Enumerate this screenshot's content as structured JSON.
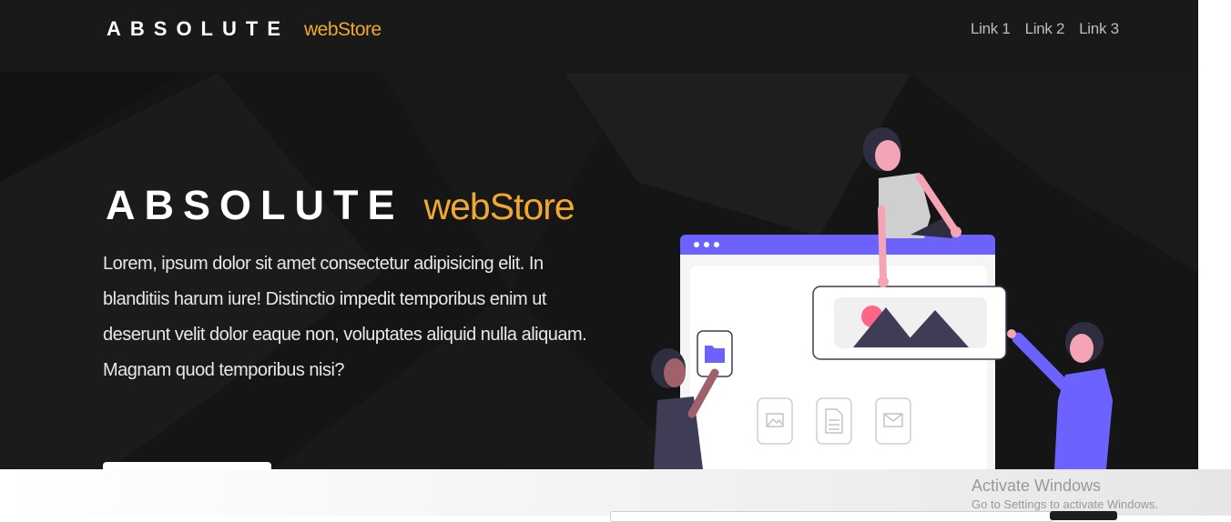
{
  "navbar": {
    "brand_main": "ABSOLUTE",
    "brand_sub": "webStore",
    "links": [
      "Link 1",
      "Link 2",
      "Link 3"
    ]
  },
  "hero": {
    "title_main": "ABSOLUTE",
    "title_sub": "webStore",
    "text": "Lorem, ipsum dolor sit amet consectetur adipisicing elit. In blanditiis harum iure! Distinctio impedit temporibus enim ut deserunt velit dolor eaque non, voluptates aliquid nulla aliquam. Magnam quod temporibus nisi?"
  },
  "watermark": {
    "title": "Activate Windows",
    "subtitle": "Go to Settings to activate Windows."
  },
  "colors": {
    "hero_bg": "#151515",
    "accent": "#f0a830",
    "illustration_purple": "#6c63ff",
    "illustration_pink": "#f4a4b4",
    "illustration_dark": "#3f3d56"
  },
  "icons": [
    "folder-icon",
    "image-icon",
    "document-icon",
    "mail-icon",
    "mountain-image-icon"
  ]
}
